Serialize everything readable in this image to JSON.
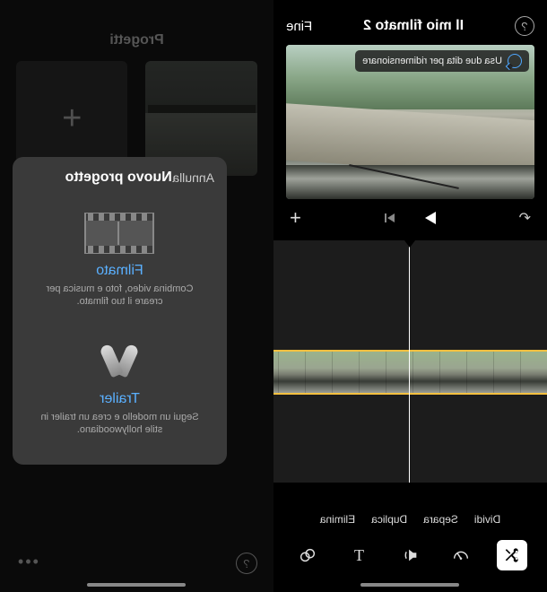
{
  "editor": {
    "help_symbol": "?",
    "title": "Il mio filmato 2",
    "done_label": "Fine",
    "hint": "Usa due dita per ridimensionare",
    "add_symbol": "+",
    "undo_symbol": "↶",
    "actions": {
      "divide": "Dividi",
      "separate": "Separa",
      "duplicate": "Duplica",
      "delete": "Elimina"
    },
    "tool_text": "T"
  },
  "projects": {
    "header": "Progetti",
    "plus_symbol": "+"
  },
  "modal": {
    "cancel": "Annulla",
    "title": "Nuovo progetto",
    "movie": {
      "title": "Filmato",
      "desc": "Combina video, foto e musica per creare il tuo filmato."
    },
    "trailer": {
      "title": "Trailer",
      "desc": "Segui un modello e crea un trailer in stile hollywoodiano."
    }
  },
  "bottom_right": {
    "help": "?",
    "more": "•••"
  }
}
